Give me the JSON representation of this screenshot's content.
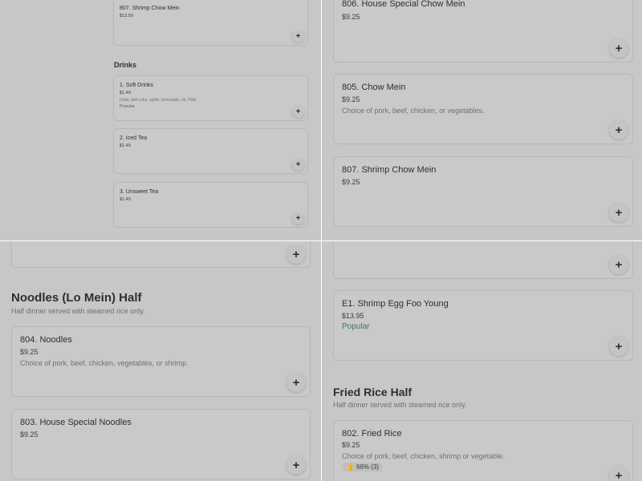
{
  "top_left": {
    "items_top": [
      {
        "name": "807. Shrimp Chow Mein",
        "price": "$13.50",
        "add_icon": "+"
      }
    ],
    "drinks_section": {
      "title": "Drinks",
      "items": [
        {
          "name": "1. Soft Drinks",
          "price": "$1.49",
          "description": "Coke, diet coke, sprite, lemonade, mr. Pibb.",
          "badge": "Popular",
          "add_icon": "+"
        },
        {
          "name": "2. Iced Tea",
          "price": "$1.49",
          "add_icon": "+"
        },
        {
          "name": "3. Unsweet Tea",
          "price": "$1.49",
          "add_icon": "+"
        }
      ]
    }
  },
  "top_right": {
    "items": [
      {
        "name": "806. House Special Chow Mein",
        "price": "$9.25",
        "add_icon": "+"
      },
      {
        "name": "805. Chow Mein",
        "price": "$9.25",
        "description": "Choice of pork, beef, chicken, or vegetables.",
        "add_icon": "+"
      },
      {
        "name": "807. Shrimp Chow Mein",
        "price": "$9.25",
        "add_icon": "+"
      }
    ]
  },
  "bottom_left": {
    "partial_card_add_icon": "+",
    "section": {
      "title": "Noodles (Lo Mein) Half",
      "subtitle": "Half dinner served with steamed rice only."
    },
    "items": [
      {
        "name": "804. Noodles",
        "price": "$9.25",
        "description": "Choice of pork, beef, chicken, vegetables, or shrimp.",
        "add_icon": "+"
      },
      {
        "name": "803. House Special Noodles",
        "price": "$9.25",
        "add_icon": "+"
      }
    ]
  },
  "bottom_right": {
    "partial_card_add_icon": "+",
    "items_top": [
      {
        "name": "E1. Shrimp Egg Foo Young",
        "price": "$13.95",
        "badge": "Popular",
        "add_icon": "+"
      }
    ],
    "section": {
      "title": "Fried Rice Half",
      "subtitle": "Half dinner served with steamed rice only."
    },
    "items": [
      {
        "name": "802. Fried Rice",
        "price": "$9.25",
        "description": "Choice of pork, beef, chicken, shrimp or vegetable.",
        "rating": "66% (3)",
        "add_icon": "+"
      }
    ]
  },
  "icons": {
    "add": "plus-icon",
    "thumbs_up": "thumbs-up-icon"
  },
  "colors": {
    "overlay_bg": "#c7c7c7",
    "card_bg": "#c9c9c9",
    "popular": "#3d7a53"
  }
}
